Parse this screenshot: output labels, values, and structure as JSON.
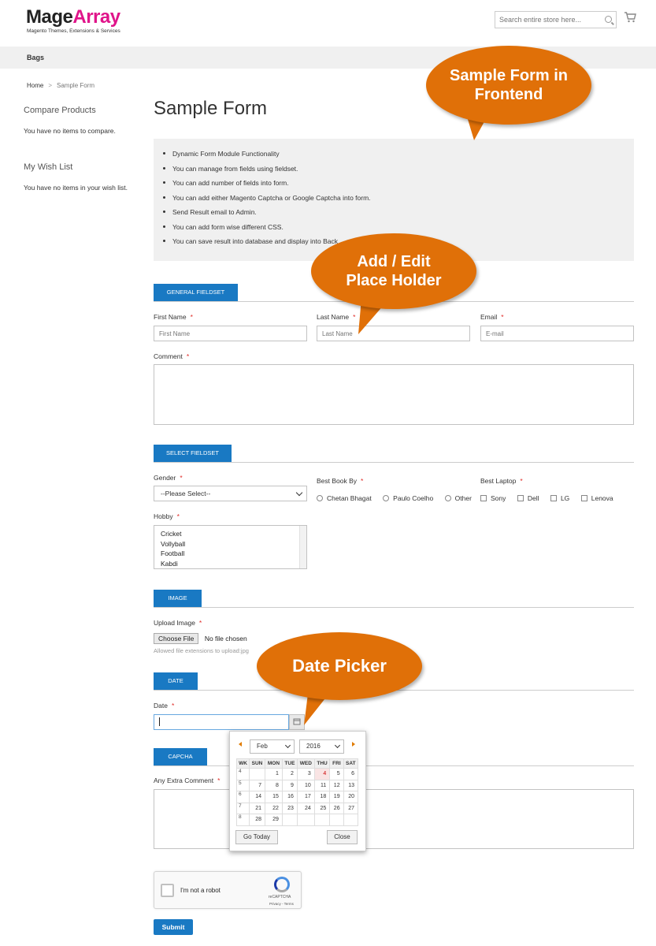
{
  "header": {
    "logo_main": "Mage",
    "logo_accent": "Array",
    "tagline": "Magento Themes, Extensions & Services",
    "search_placeholder": "Search entire store here...",
    "colors": {
      "accent": "#e0148a",
      "primary": "#1979c3",
      "callout": "#e07008"
    }
  },
  "nav": {
    "item": "Bags"
  },
  "breadcrumb": {
    "home": "Home",
    "separator": ">",
    "current": "Sample Form"
  },
  "sidebar": {
    "compare_title": "Compare Products",
    "compare_text": "You have no items to compare.",
    "wishlist_title": "My Wish List",
    "wishlist_text": "You have no items in your wish list."
  },
  "main": {
    "title": "Sample Form",
    "features": [
      "Dynamic Form Module Functionality",
      "You can manage from fields using fieldset.",
      "You can add number of fields into form.",
      "You can add either Magento Captcha or Google Captcha into form.",
      "Send Result email to Admin.",
      "You can add form wise different CSS.",
      "You can save result into database and display into Back"
    ]
  },
  "general": {
    "tab": "GENERAL FIELDSET",
    "first_name_label": "First Name",
    "first_name_placeholder": "First Name",
    "last_name_label": "Last Name",
    "last_name_placeholder": "Last Name",
    "email_label": "Email",
    "email_placeholder": "E-mail",
    "comment_label": "Comment",
    "required": "*"
  },
  "select": {
    "tab": "SELECT FIELDSET",
    "gender_label": "Gender",
    "gender_value": "--Please Select--",
    "book_label": "Best Book By",
    "books": [
      "Chetan Bhagat",
      "Paulo Coelho",
      "Other"
    ],
    "laptop_label": "Best Laptop",
    "laptops": [
      "Sony",
      "Dell",
      "LG",
      "Lenova"
    ],
    "hobby_label": "Hobby",
    "hobbies": [
      "Cricket",
      "Vollyball",
      "Football",
      "Kabdi"
    ]
  },
  "image": {
    "tab": "IMAGE",
    "upload_label": "Upload Image",
    "choose_file": "Choose File",
    "no_file": "No file chosen",
    "help": "Allowed file extensions to upload:jpg"
  },
  "date": {
    "tab": "DATE",
    "label": "Date"
  },
  "datepicker": {
    "month": "Feb",
    "year": "2016",
    "headers": [
      "WK",
      "SUN",
      "MON",
      "TUE",
      "WED",
      "THU",
      "FRI",
      "SAT"
    ],
    "weeks": [
      [
        "4",
        "",
        "1",
        "2",
        "3",
        "4",
        "5",
        "6"
      ],
      [
        "5",
        "7",
        "8",
        "9",
        "10",
        "11",
        "12",
        "13"
      ],
      [
        "6",
        "14",
        "15",
        "16",
        "17",
        "18",
        "19",
        "20"
      ],
      [
        "7",
        "21",
        "22",
        "23",
        "24",
        "25",
        "26",
        "27"
      ],
      [
        "8",
        "28",
        "29",
        "",
        "",
        "",
        "",
        ""
      ]
    ],
    "today_label": "Go Today",
    "close_label": "Close"
  },
  "captcha": {
    "tab": "CAPCHA",
    "comment_label": "Any Extra Comment",
    "robot_text": "I'm not a robot",
    "brand": "reCAPTCHA",
    "privacy": "Privacy - Terms"
  },
  "submit_label": "Submit",
  "callouts": {
    "frontend": "Sample Form in Frontend",
    "placeholder": "Add / Edit Place Holder",
    "datepicker": "Date Picker"
  }
}
